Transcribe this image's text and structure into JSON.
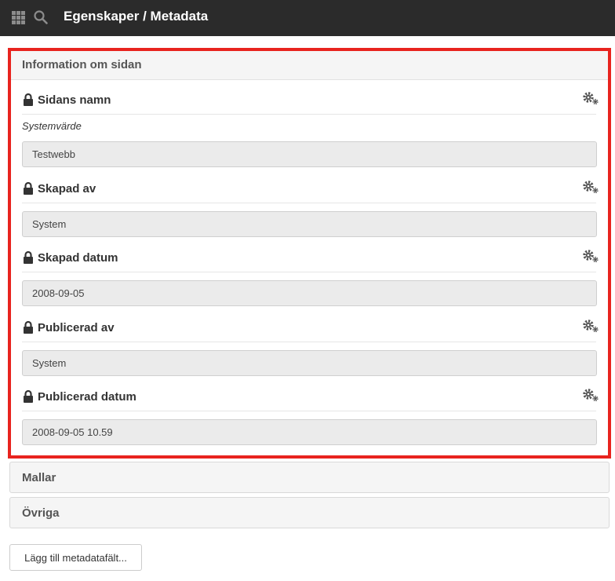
{
  "header": {
    "title": "Egenskaper / Metadata"
  },
  "info_panel": {
    "title": "Information om sidan",
    "fields": [
      {
        "label": "Sidans namn",
        "note": "Systemvärde",
        "value": "Testwebb"
      },
      {
        "label": "Skapad av",
        "value": "System"
      },
      {
        "label": "Skapad datum",
        "value": "2008-09-05"
      },
      {
        "label": "Publicerad av",
        "value": "System"
      },
      {
        "label": "Publicerad datum",
        "value": "2008-09-05 10.59"
      }
    ]
  },
  "panels": {
    "templates": "Mallar",
    "other": "Övriga"
  },
  "actions": {
    "add_metadata": "Lägg till metadatafält..."
  },
  "colors": {
    "topbar": "#2b2b2b",
    "highlight": "#e8231e"
  }
}
